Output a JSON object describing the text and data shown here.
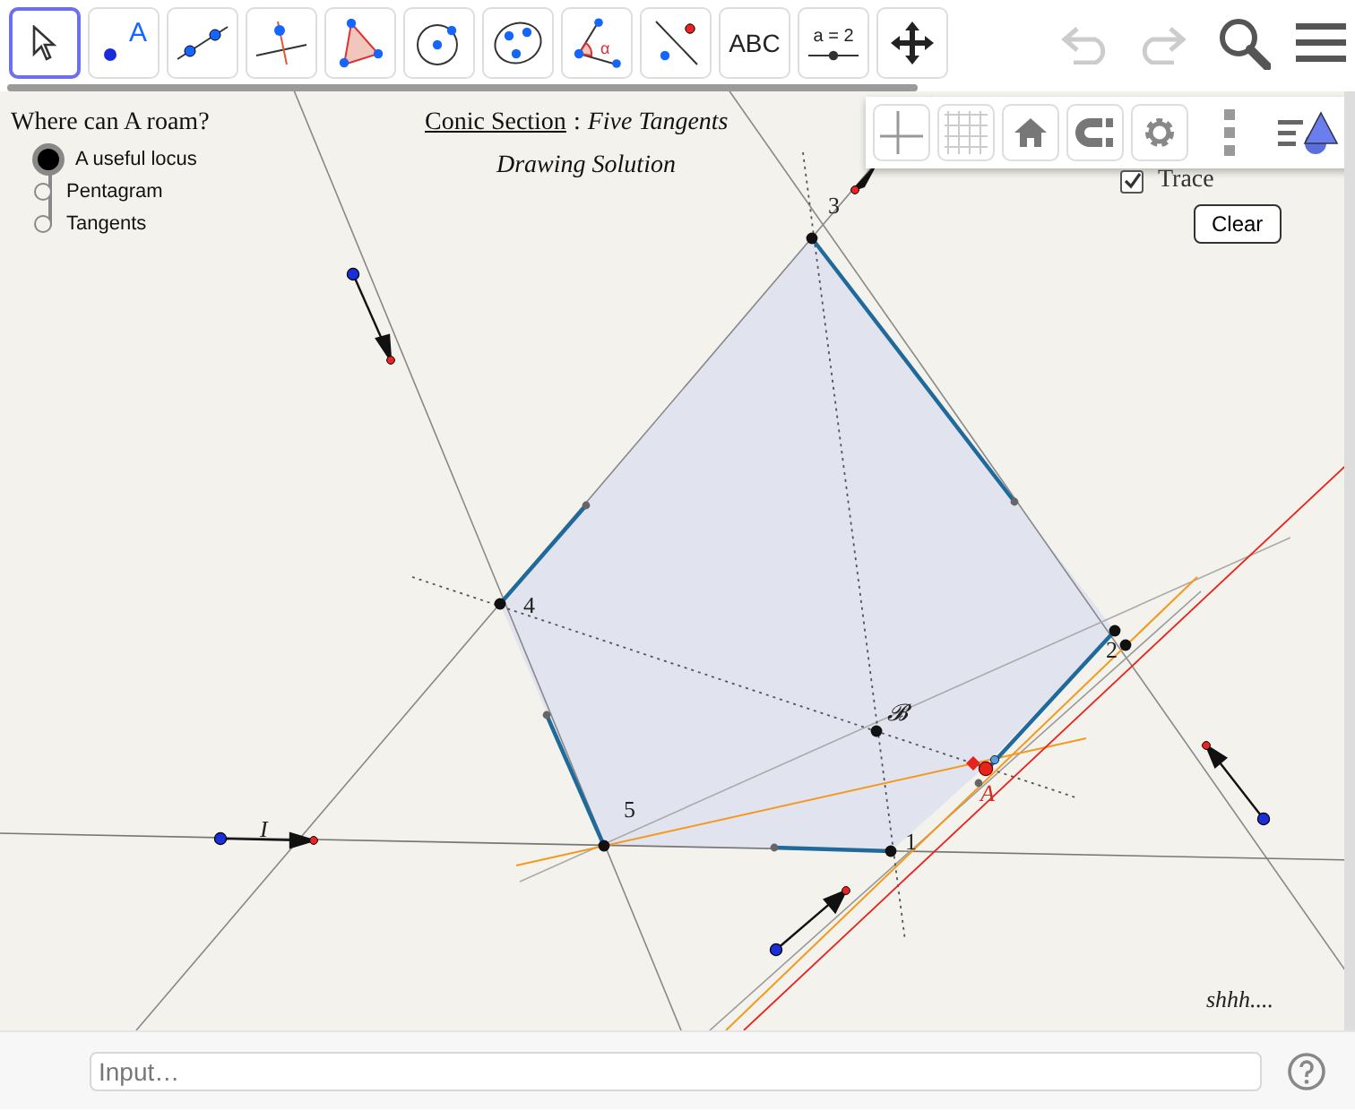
{
  "toolbar": {
    "tools": [
      {
        "kind": "move",
        "selected": true
      },
      {
        "kind": "point",
        "label": "A",
        "selected": false
      },
      {
        "kind": "line",
        "selected": false
      },
      {
        "kind": "perpendicular",
        "selected": false
      },
      {
        "kind": "polygon",
        "selected": false
      },
      {
        "kind": "circle",
        "selected": false
      },
      {
        "kind": "conic",
        "selected": false
      },
      {
        "kind": "angle",
        "label": "α",
        "selected": false
      },
      {
        "kind": "reflect",
        "selected": false
      },
      {
        "kind": "text",
        "label": "ABC",
        "selected": false
      },
      {
        "kind": "slider",
        "label": "a = 2",
        "selected": false
      },
      {
        "kind": "pan",
        "selected": false
      }
    ],
    "undo": {
      "disabled": true
    },
    "redo": {
      "disabled": true
    }
  },
  "canvas": {
    "question": "Where can A roam?",
    "options": [
      {
        "label": "A useful locus",
        "selected": true
      },
      {
        "label": "Pentagram",
        "selected": false
      },
      {
        "label": "Tangents",
        "selected": false
      }
    ],
    "heading": {
      "underlined": "Conic Section",
      "separator": ":",
      "italic": "Five Tangents"
    },
    "subheading": "Drawing Solution",
    "trace": {
      "label": "Trace",
      "checked": true
    },
    "clear_button": "Clear",
    "point_labels": [
      "3",
      "4",
      "2",
      "1",
      "5",
      "𝓑",
      "A",
      "I"
    ],
    "note": "shhh...."
  },
  "style_bar": {
    "buttons": [
      {
        "kind": "axes",
        "selected": false
      },
      {
        "kind": "grid",
        "selected": false
      },
      {
        "kind": "home",
        "selected": false
      },
      {
        "kind": "magnet",
        "selected": false
      },
      {
        "kind": "settings",
        "selected": false
      },
      {
        "kind": "more",
        "selected": false
      }
    ]
  },
  "input_bar": {
    "placeholder": "Input…"
  }
}
